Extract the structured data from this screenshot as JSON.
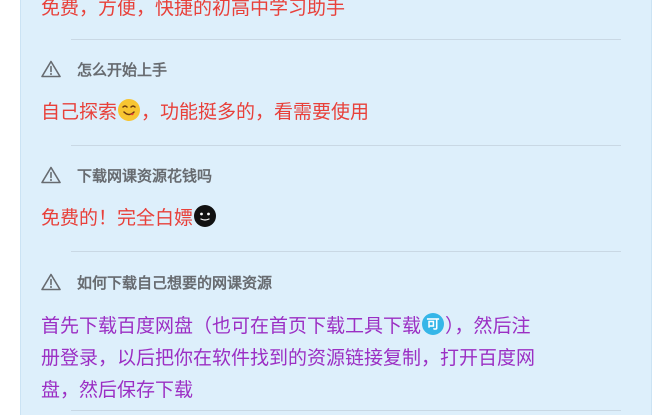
{
  "faq": {
    "intro_answer": "免费，方便，快捷的初高中学习助手",
    "items": [
      {
        "question": "怎么开始上手",
        "answer_prefix": "自己探索",
        "answer_suffix": "，功能挺多的，看需要使用",
        "emoji": "yummy-face-emoji"
      },
      {
        "question": "下载网课资源花钱吗",
        "answer_prefix": "免费的！完全白嫖",
        "answer_suffix": "",
        "emoji": "dark-face-emoji"
      },
      {
        "question": "如何下载自己想要的网课资源",
        "answer_line1_prefix": "首先下载百度网盘（也可在首页下载工具下载",
        "answer_line1_suffix": "），然后注",
        "answer_line2": "册登录，以后把你在软件找到的资源链接复制，打开百度网",
        "answer_line3": "盘，然后保存下载",
        "emoji": "ke-badge-emoji",
        "emoji_text": "可"
      }
    ]
  },
  "icons": {
    "question_icon": "warning-triangle-icon"
  },
  "colors": {
    "answer_red": "#e8403a",
    "answer_purple": "#9b2fc4",
    "question_gray": "#676b70",
    "panel_bg": "#ddeffb"
  }
}
